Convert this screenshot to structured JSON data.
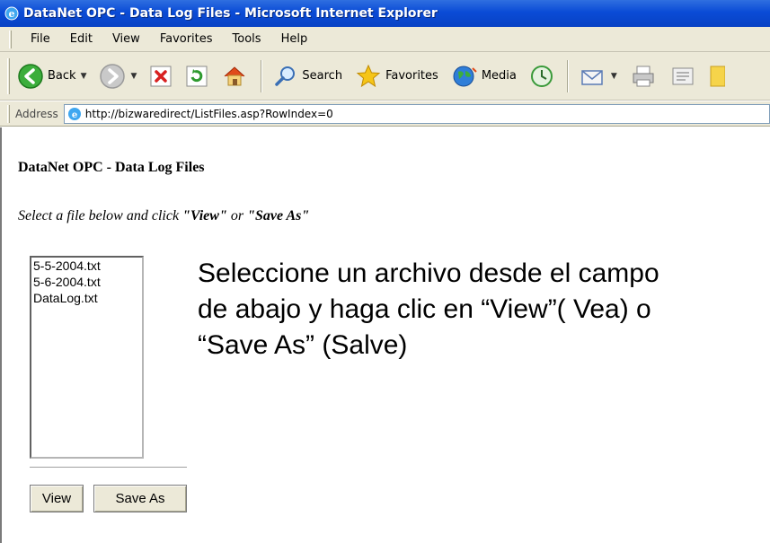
{
  "window": {
    "title": "DataNet OPC - Data Log Files - Microsoft Internet Explorer"
  },
  "menu": {
    "items": [
      "File",
      "Edit",
      "View",
      "Favorites",
      "Tools",
      "Help"
    ]
  },
  "toolbar": {
    "back_label": "Back",
    "search_label": "Search",
    "favorites_label": "Favorites",
    "media_label": "Media"
  },
  "address": {
    "label": "Address",
    "url": "http://bizwaredirect/ListFiles.asp?RowIndex=0"
  },
  "page": {
    "heading": "DataNet OPC - Data Log Files",
    "instruction_prefix": "Select a file below and click ",
    "instruction_view": "\"View\"",
    "instruction_or": " or ",
    "instruction_save": "\"Save As\"",
    "files": [
      "5-5-2004.txt",
      "5-6-2004.txt",
      "DataLog.txt"
    ],
    "view_button": "View",
    "save_button": "Save As",
    "overlay_line1": "Seleccione un archivo desde el campo",
    "overlay_line2": "de abajo y haga clic en “View”( Vea) o",
    "overlay_line3": "“Save As” (Salve)"
  }
}
